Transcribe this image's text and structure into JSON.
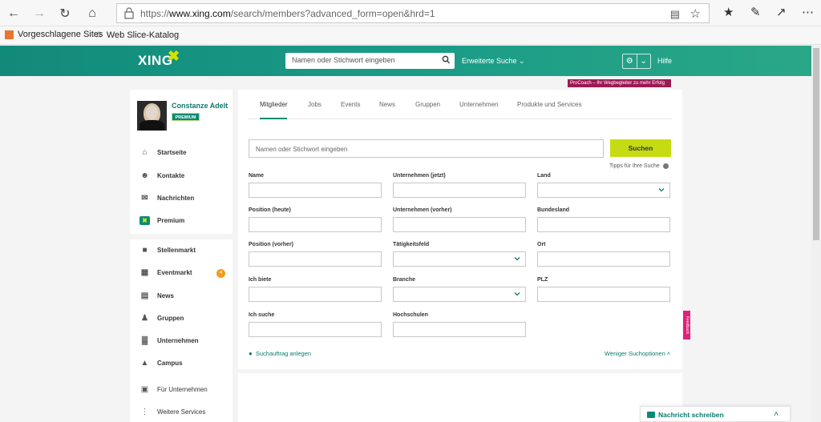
{
  "browser": {
    "url_prefix": "https://",
    "url_domain": "www.xing.com",
    "url_path": "/search/members?advanced_form=open&hrd=1",
    "favorites": [
      "Vorgeschlagene Sites",
      "Web Slice-Katalog"
    ]
  },
  "header": {
    "logo": "XING",
    "search_placeholder": "Namen oder Stichwort eingeben",
    "advanced_search": "Erweiterte Suche",
    "help": "Hilfe",
    "procoach_banner": "ProCoach – Ihr Wegbegleiter zu mehr Erfolg"
  },
  "profile": {
    "name": "Constanze Adelt",
    "badge": "PREMIUM"
  },
  "sidebar": {
    "items": [
      {
        "label": "Startseite",
        "icon": "home-icon"
      },
      {
        "label": "Kontakte",
        "icon": "contacts-icon"
      },
      {
        "label": "Nachrichten",
        "icon": "messages-icon"
      },
      {
        "label": "Premium",
        "icon": "premium-icon"
      },
      {
        "label": "Stellenmarkt",
        "icon": "jobs-icon"
      },
      {
        "label": "Eventmarkt",
        "icon": "calendar-icon"
      },
      {
        "label": "News",
        "icon": "news-icon"
      },
      {
        "label": "Gruppen",
        "icon": "groups-icon"
      },
      {
        "label": "Unternehmen",
        "icon": "company-icon"
      },
      {
        "label": "Campus",
        "icon": "campus-icon"
      },
      {
        "label": "Für Unternehmen",
        "icon": "business-icon"
      },
      {
        "label": "Weitere Services",
        "icon": "services-icon"
      }
    ],
    "event_badge": "4"
  },
  "tabs": [
    "Mitglieder",
    "Jobs",
    "Events",
    "News",
    "Gruppen",
    "Unternehmen",
    "Produkte und Services"
  ],
  "search": {
    "placeholder": "Namen oder Stichwort eingeben",
    "button": "Suchen",
    "tips": "Tipps für Ihre Suche"
  },
  "fields": {
    "name": "Name",
    "company_now": "Unternehmen (jetzt)",
    "country": "Land",
    "position_now": "Position (heute)",
    "company_before": "Unternehmen (vorher)",
    "state": "Bundesland",
    "position_before": "Position (vorher)",
    "field": "Tätigkeitsfeld",
    "city": "Ort",
    "offer": "Ich biete",
    "industry": "Branche",
    "zip": "PLZ",
    "seek": "Ich suche",
    "universities": "Hochschulen"
  },
  "footer_links": {
    "save_search": "Suchauftrag anlegen",
    "fewer_options": "Weniger Suchoptionen"
  },
  "feedback": "Feedback",
  "message_bar": "Nachricht schreiben",
  "colors": {
    "brand_teal": "#128a7a",
    "accent_lime": "#c6dc12",
    "procoach": "#9b1a54",
    "feedback": "#e0217a",
    "badge_orange": "#f29b1a"
  }
}
